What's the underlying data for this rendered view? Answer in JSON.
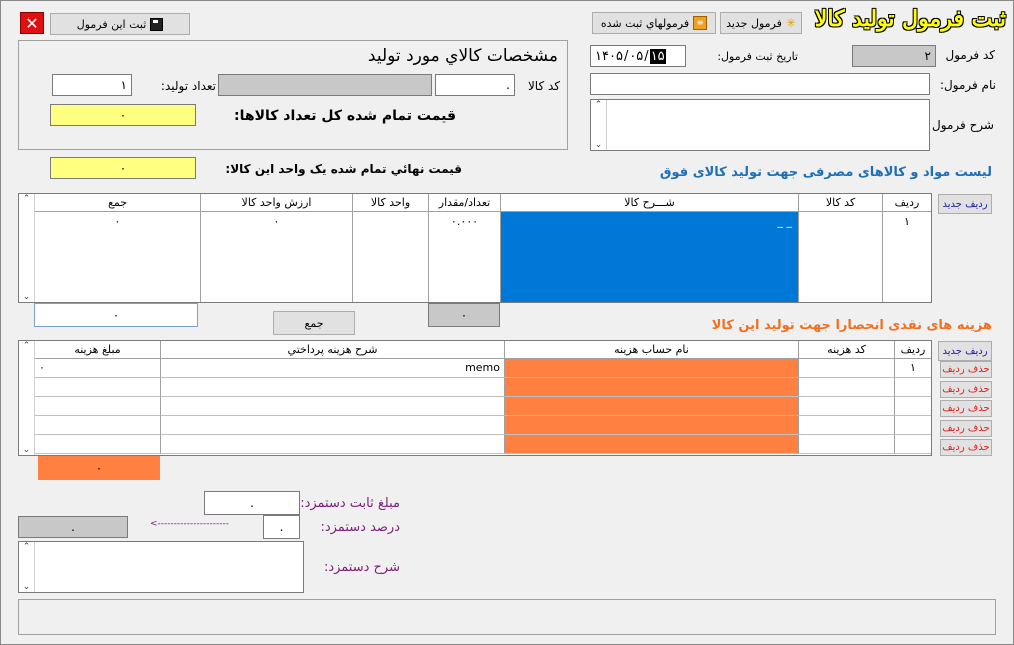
{
  "title": "ثبت فرمول تولید کالا",
  "toolbar": {
    "new_formula": "فرمول جدید",
    "saved_formulas": "فرمولهاي ثبت شده",
    "save_formula": "ثبت این فرمول"
  },
  "header": {
    "formula_code_label": "کد فرمول",
    "formula_code_value": "۲",
    "formula_name_label": "نام فرمول:",
    "formula_name_value": "",
    "formula_desc_label": "شرح فرمول",
    "date_label": "تاریخ ثبت فرمول:",
    "date_year": "۱۴۰۵",
    "date_month": "۰۵",
    "date_day": "۱۵"
  },
  "product": {
    "heading": "مشخصات کالاي مورد تولید",
    "code_label": "کد کالا",
    "code_value": ".",
    "qty_label": "تعداد تولید:",
    "qty_value": "۱",
    "total_cost_label": "قیمت تمام شده کل تعداد کالاها:",
    "total_cost_value": "۰",
    "unit_cost_label": "قیمت نهائي تمام شده یک واحد این کالا:",
    "unit_cost_value": "۰"
  },
  "materials": {
    "heading": "لیست مواد و کالاهای مصرفی جهت تولید کالای فوق",
    "new_row": "ردیف جدید",
    "columns": [
      "ردیف",
      "کد کالا",
      "شـــرح کالا",
      "تعداد/مقدار",
      "واحد کالا",
      "ارزش واحد کالا",
      "جمع"
    ],
    "row": {
      "idx": "۱",
      "code": "",
      "desc": "_ _",
      "qty": "۰.۰۰۰",
      "unit": "",
      "unit_value": "۰",
      "sum": "۰"
    },
    "sum_button": "جمع",
    "total_qty": "۰",
    "total_sum": "۰"
  },
  "costs": {
    "heading": "هزینه های نقدی انحصارا جهت تولید این کالا",
    "new_row": "ردیف جدید",
    "delete_row": "حذف ردیف",
    "columns": [
      "ردیف",
      "کد هزینه",
      "نام حساب هزینه",
      "شرح هزینه پرداختي",
      "مبلغ هزینه"
    ],
    "rows": [
      {
        "idx": "۱",
        "code": "",
        "account": "",
        "desc": "memo",
        "amount": "۰"
      },
      {
        "idx": "",
        "code": "",
        "account": "",
        "desc": "",
        "amount": ""
      },
      {
        "idx": "",
        "code": "",
        "account": "",
        "desc": "",
        "amount": ""
      },
      {
        "idx": "",
        "code": "",
        "account": "",
        "desc": "",
        "amount": ""
      },
      {
        "idx": "",
        "code": "",
        "account": "",
        "desc": "",
        "amount": ""
      }
    ],
    "total": "۰"
  },
  "wage": {
    "fixed_label": "مبلغ ثابت دستمزد:",
    "fixed_value": ".",
    "percent_label": "درصد دستمزد:",
    "percent_value": ".",
    "arrow": "<----------------------",
    "computed_value": ".",
    "desc_label": "شرح دستمزد:"
  },
  "colors": {
    "accent_blue": "#0070c0",
    "heading_blue": "#1f6fb5",
    "heading_orange": "#f07020",
    "purple": "#7a1f7a",
    "yellow": "#ffff80",
    "orange": "#ff8040",
    "selected": "#0078d7"
  }
}
